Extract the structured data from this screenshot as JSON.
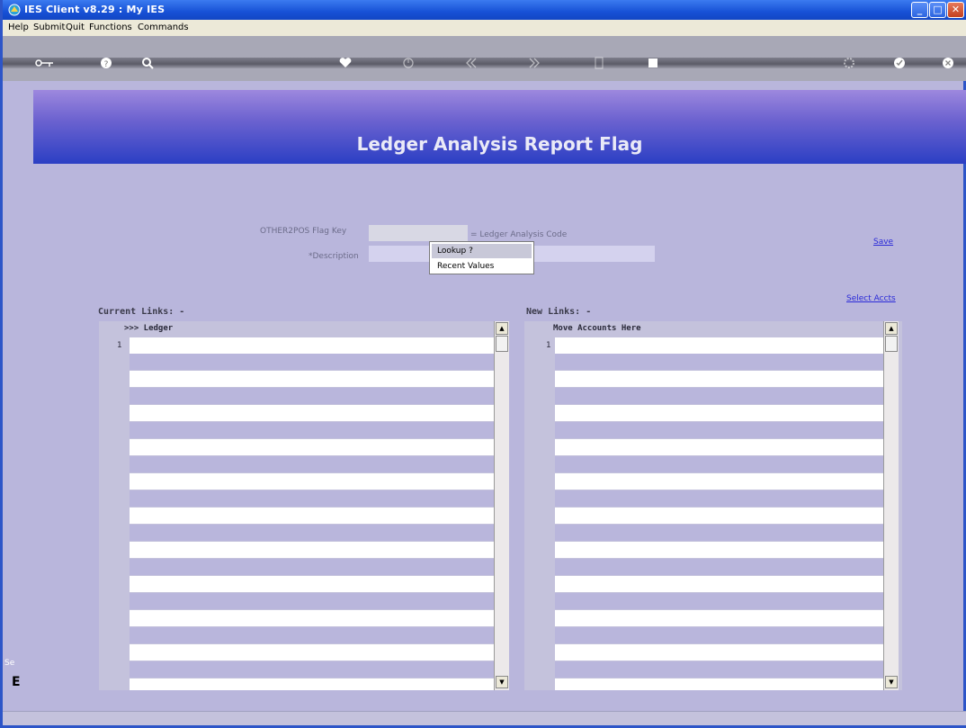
{
  "window": {
    "title": "IES Client v8.29 : My IES",
    "minimize_label": "_",
    "maximize_label": "□",
    "close_label": "✕"
  },
  "menu": [
    "Help",
    "Submit",
    "Quit",
    "Functions",
    "Commands"
  ],
  "toolbar": {
    "icons": [
      "key-icon",
      "help-icon",
      "search-icon",
      "heart-icon",
      "clock-icon",
      "rewind-icon",
      "forward-icon",
      "page-icon",
      "square-icon",
      "settings-icon",
      "check-icon",
      "close-icon"
    ]
  },
  "banner": {
    "title": "Ledger Analysis Report Flag"
  },
  "form": {
    "flag_key_label": "OTHER2POS Flag Key",
    "flag_key_value": "",
    "ledger_analysis_label": "= Ledger Analysis Code",
    "description_label": "*Description",
    "description_value": ""
  },
  "popup": {
    "items": [
      "Lookup ?",
      "Recent Values"
    ]
  },
  "links": {
    "save": "Save",
    "select_accts": "Select Accts"
  },
  "current_links": {
    "title": "Current Links: -",
    "header": ">>> Ledger",
    "first_row_number": "1"
  },
  "new_links": {
    "title": "New Links: -",
    "header": "Move Accounts Here",
    "first_row_number": "1"
  },
  "side": {
    "label1": "Se",
    "label2": "E"
  },
  "colors": {
    "banner_dark": "#2b3fc4",
    "banner_light": "#9d88de",
    "row_light": "#ffffff",
    "row_dark": "#b9b6dc"
  }
}
